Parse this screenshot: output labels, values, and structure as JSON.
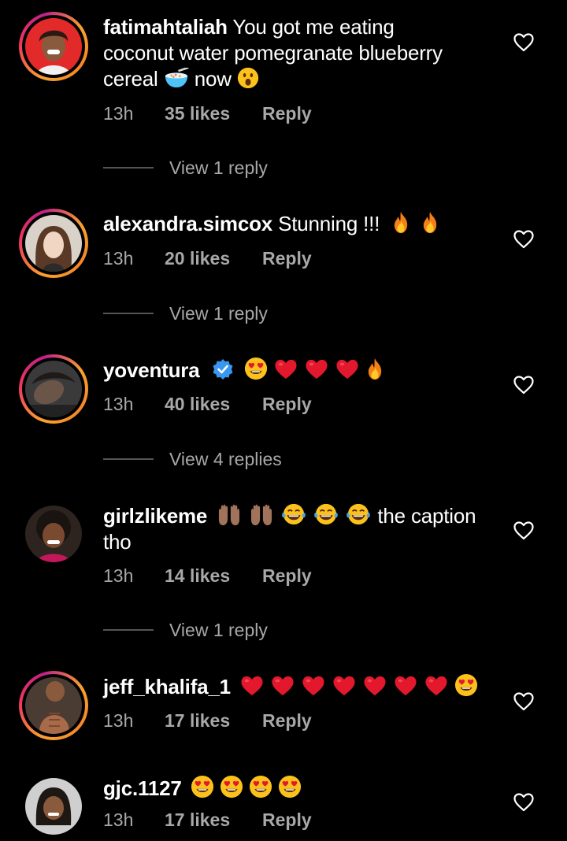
{
  "comments": [
    {
      "username": "fatimahtaliah",
      "text_line1": "You got me eating",
      "text_line2": "coconut water pomegranate blueberry",
      "text_line3a": "cereal",
      "text_line3b": "now",
      "time": "13h",
      "likes": "35 likes",
      "reply": "Reply",
      "view_replies": "View 1 reply",
      "emoji_icons": [
        "bowl-cereal-emoji",
        "astonished-face-emoji"
      ]
    },
    {
      "username": "alexandra.simcox",
      "text": "Stunning !!!",
      "time": "13h",
      "likes": "20 likes",
      "reply": "Reply",
      "view_replies": "View 1 reply",
      "emoji_icons": [
        "fire-emoji",
        "fire-emoji"
      ]
    },
    {
      "username": "yoventura",
      "verified": true,
      "time": "13h",
      "likes": "40 likes",
      "reply": "Reply",
      "view_replies": "View 4 replies",
      "emoji_icons": [
        "heart-eyes-emoji",
        "red-heart-emoji",
        "red-heart-emoji",
        "red-heart-emoji",
        "fire-emoji"
      ]
    },
    {
      "username": "girlzlikeme",
      "text_after_emoji": "the caption",
      "text_line2": "tho",
      "time": "13h",
      "likes": "14 likes",
      "reply": "Reply",
      "view_replies": "View 1 reply",
      "emoji_icons": [
        "raised-hands-emoji",
        "raised-hands-emoji",
        "tears-of-joy-emoji",
        "tears-of-joy-emoji",
        "tears-of-joy-emoji"
      ]
    },
    {
      "username": "jeff_khalifa_1",
      "time": "13h",
      "likes": "17 likes",
      "reply": "Reply",
      "emoji_icons": [
        "red-heart-emoji",
        "red-heart-emoji",
        "red-heart-emoji",
        "red-heart-emoji",
        "red-heart-emoji",
        "red-heart-emoji",
        "red-heart-emoji",
        "heart-eyes-emoji"
      ]
    },
    {
      "username": "gjc.1127",
      "time": "13h",
      "likes": "17 likes",
      "reply": "Reply",
      "emoji_icons": [
        "heart-eyes-emoji",
        "heart-eyes-emoji",
        "heart-eyes-emoji",
        "heart-eyes-emoji"
      ]
    }
  ],
  "colors": {
    "background": "#000000",
    "text": "#ffffff",
    "meta": "#a8a8a8",
    "story_ring": [
      "#f9a12e",
      "#f2385a",
      "#c0208a"
    ],
    "verified": "#3897f0",
    "heart": "#e4182d"
  }
}
